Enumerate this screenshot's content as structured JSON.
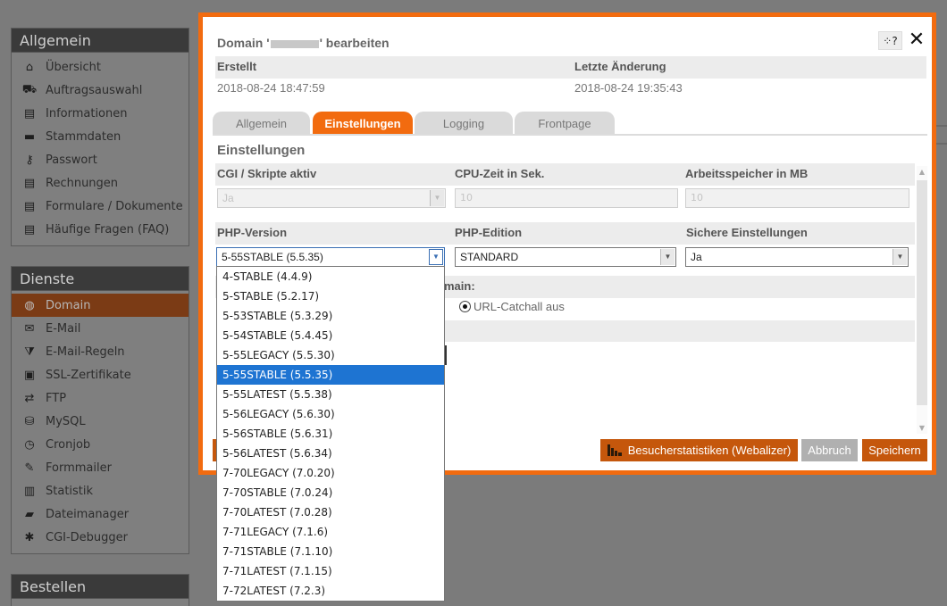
{
  "sidebar": {
    "general": {
      "title": "Allgemein",
      "items": [
        {
          "label": "Übersicht",
          "icon": "home-icon"
        },
        {
          "label": "Auftragsauswahl",
          "icon": "cart-icon"
        },
        {
          "label": "Informationen",
          "icon": "document-icon"
        },
        {
          "label": "Stammdaten",
          "icon": "card-icon"
        },
        {
          "label": "Passwort",
          "icon": "key-icon"
        },
        {
          "label": "Rechnungen",
          "icon": "document-icon"
        },
        {
          "label": "Formulare / Dokumente",
          "icon": "document-icon"
        },
        {
          "label": "Häufige Fragen (FAQ)",
          "icon": "document-icon"
        }
      ]
    },
    "services": {
      "title": "Dienste",
      "items": [
        {
          "label": "Domain",
          "icon": "globe-icon"
        },
        {
          "label": "E-Mail",
          "icon": "mail-icon"
        },
        {
          "label": "E-Mail-Regeln",
          "icon": "filter-icon"
        },
        {
          "label": "SSL-Zertifikate",
          "icon": "lock-icon"
        },
        {
          "label": "FTP",
          "icon": "ftp-icon"
        },
        {
          "label": "MySQL",
          "icon": "database-icon"
        },
        {
          "label": "Cronjob",
          "icon": "clock-icon"
        },
        {
          "label": "Formmailer",
          "icon": "edit-icon"
        },
        {
          "label": "Statistik",
          "icon": "bar-chart-icon"
        },
        {
          "label": "Dateimanager",
          "icon": "folder-icon"
        },
        {
          "label": "CGI-Debugger",
          "icon": "bug-icon"
        }
      ]
    },
    "order": {
      "title": "Bestellen"
    }
  },
  "modal": {
    "title_prefix": "Domain '",
    "title_suffix": "' bearbeiten",
    "help_label": "?",
    "close_label": "✕",
    "created_label": "Erstellt",
    "created_value": "2018-08-24 18:47:59",
    "changed_label": "Letzte Änderung",
    "changed_value": "2018-08-24 19:35:43",
    "tabs": [
      "Allgemein",
      "Einstellungen",
      "Logging",
      "Frontpage"
    ],
    "active_tab": "Einstellungen",
    "section_title": "Einstellungen",
    "fields": {
      "cgi_label": "CGI / Skripte aktiv",
      "cgi_value": "Ja",
      "cpu_label": "CPU-Zeit in Sek.",
      "cpu_value": "10",
      "mem_label": "Arbeitsspeicher in MB",
      "mem_value": "10",
      "php_version_label": "PHP-Version",
      "php_version_value": "5-55STABLE (5.5.35)",
      "php_edition_label": "PHP-Edition",
      "php_edition_value": "STANDARD",
      "safe_label": "Sichere Einstellungen",
      "safe_value": "Ja",
      "catchall_label_tail": "main:",
      "catchall_option": "URL-Catchall aus"
    },
    "buttons": {
      "stats": "Besucherstatistiken (Webalizer)",
      "cancel": "Abbruch",
      "save": "Speichern"
    }
  },
  "php_dropdown": {
    "selected": "5-55STABLE (5.5.35)",
    "options": [
      "4-STABLE (4.4.9)",
      "5-STABLE (5.2.17)",
      "5-53STABLE (5.3.29)",
      "5-54STABLE (5.4.45)",
      "5-55LEGACY (5.5.30)",
      "5-55STABLE (5.5.35)",
      "5-55LATEST (5.5.38)",
      "5-56LEGACY (5.6.30)",
      "5-56STABLE (5.6.31)",
      "5-56LATEST (5.6.34)",
      "7-70LEGACY (7.0.20)",
      "7-70STABLE (7.0.24)",
      "7-70LATEST (7.0.28)",
      "7-71LEGACY (7.1.6)",
      "7-71STABLE (7.1.10)",
      "7-71LATEST (7.1.15)",
      "7-72LATEST (7.2.3)"
    ]
  },
  "colors": {
    "accent": "#f26b0f",
    "active_nav": "#7b3b15",
    "selected_option": "#1e74d2"
  }
}
